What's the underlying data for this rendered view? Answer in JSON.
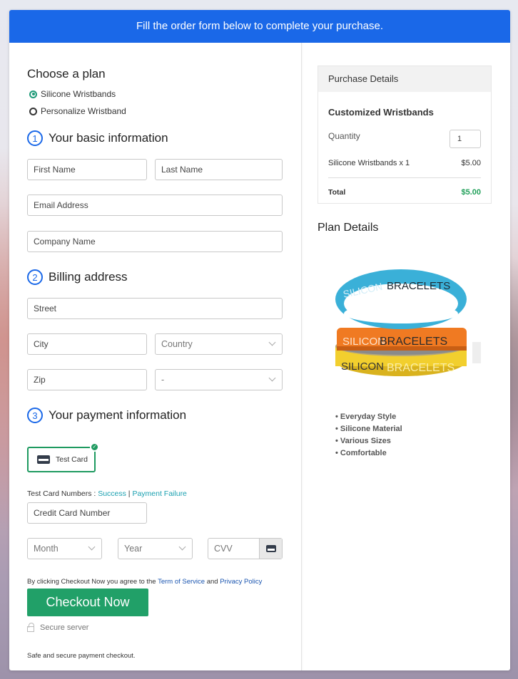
{
  "banner": {
    "text": "Fill the order form below to complete your purchase."
  },
  "plan": {
    "heading": "Choose a plan",
    "options": [
      {
        "label": "Silicone Wristbands",
        "selected": true
      },
      {
        "label": "Personalize Wristband",
        "selected": false
      }
    ]
  },
  "basic_info": {
    "number": "1",
    "heading": "Your basic information",
    "first_name_placeholder": "First Name",
    "last_name_placeholder": "Last Name",
    "email_placeholder": "Email Address",
    "company_placeholder": "Company Name"
  },
  "billing": {
    "number": "2",
    "heading": "Billing address",
    "street_placeholder": "Street",
    "city_placeholder": "City",
    "country_select": "Country",
    "zip_placeholder": "Zip",
    "state_select": "-"
  },
  "payment": {
    "number": "3",
    "heading": "Your payment information",
    "method_label": "Test Card",
    "test_numbers_label": "Test Card Numbers : ",
    "success_link": "Success",
    "separator": " | ",
    "failure_link": "Payment Failure",
    "card_number_placeholder": "Credit Card Number",
    "month_select": "Month",
    "year_select": "Year",
    "cvv_placeholder": "CVV"
  },
  "agreement": {
    "prefix": "By clicking Checkout Now you agree to the ",
    "tos_link": "Term of Service",
    "and": " and ",
    "privacy_link": "Privacy Policy"
  },
  "checkout": {
    "button_label": "Checkout Now",
    "secure_label": "Secure server",
    "safe_text": "Safe and secure payment checkout."
  },
  "purchase_details": {
    "heading": "Purchase Details",
    "product": "Customized Wristbands",
    "quantity_label": "Quantity",
    "quantity_value": "1",
    "line_item": "Silicone Wristbands x 1",
    "line_price": "$5.00",
    "total_label": "Total",
    "total_value": "$5.00"
  },
  "plan_details": {
    "heading": "Plan Details",
    "image_text": {
      "word1": "SILICON",
      "word2": "BRACELETS"
    },
    "features": [
      "Everyday Style",
      "Silicone Material",
      "Various Sizes",
      "Comfortable"
    ]
  },
  "colors": {
    "banner": "#1a68e8",
    "accent_green": "#21a068",
    "total_green": "#21a05a",
    "link_teal": "#1aa0b0",
    "bracelet_blue": "#3ab0d8",
    "bracelet_orange": "#f07a22",
    "bracelet_yellow": "#f2cf2e"
  }
}
